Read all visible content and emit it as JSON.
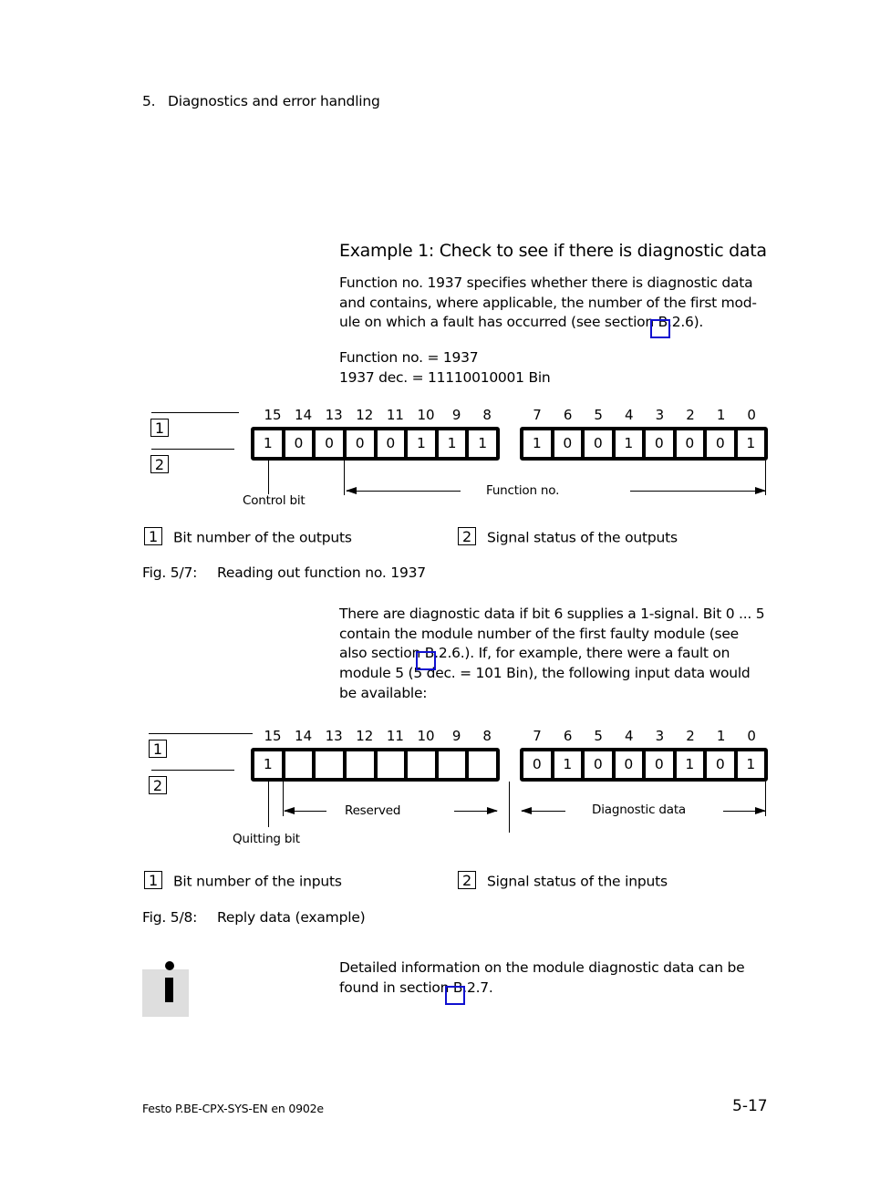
{
  "header": {
    "chapter_number": "5.",
    "chapter_title": "Diagnostics and error handling"
  },
  "example": {
    "heading": "Example 1: Check to see if there is diagnostic data",
    "paragraph1_lines": [
      "Function no. 1937 specifies whether there is diagnostic data",
      "and contains, where applicable, the number of the first mod-",
      "ule on which a fault has occurred (see section B.2.6)."
    ],
    "paragraph2_lines": [
      "Function no. = 1937",
      "1937 dec. = 11110010001 Bin"
    ]
  },
  "figure1": {
    "key1": "1",
    "key2": "2",
    "bit_numbers_high": [
      "15",
      "14",
      "13",
      "12",
      "11",
      "10",
      "9",
      "8"
    ],
    "bit_numbers_low": [
      "7",
      "6",
      "5",
      "4",
      "3",
      "2",
      "1",
      "0"
    ],
    "values_high": [
      "1",
      "0",
      "0",
      "0",
      "0",
      "1",
      "1",
      "1"
    ],
    "values_low": [
      "1",
      "0",
      "0",
      "1",
      "0",
      "0",
      "0",
      "1"
    ],
    "label_control_bit": "Control bit",
    "label_function_no": "Function no.",
    "legend1": "Bit number of the outputs",
    "legend2": "Signal status of the outputs",
    "caption_number": "Fig. 5/7:",
    "caption_text": "Reading out function no. 1937"
  },
  "paragraph3_lines": [
    "There are diagnostic data if bit 6 supplies a 1-signal. Bit 0 ... 5",
    "contain the module number of the first faulty module (see",
    "also section B.2.6.). If, for example, there were a fault on",
    "module 5 (5 dec. = 101 Bin), the following input data would",
    "be available:"
  ],
  "figure2": {
    "key1": "1",
    "key2": "2",
    "bit_numbers_high": [
      "15",
      "14",
      "13",
      "12",
      "11",
      "10",
      "9",
      "8"
    ],
    "bit_numbers_low": [
      "7",
      "6",
      "5",
      "4",
      "3",
      "2",
      "1",
      "0"
    ],
    "values_high": [
      "1",
      "",
      "",
      "",
      "",
      "",
      "",
      ""
    ],
    "values_low": [
      "0",
      "1",
      "0",
      "0",
      "0",
      "1",
      "0",
      "1"
    ],
    "label_quitting_bit": "Quitting bit",
    "label_reserved": "Reserved",
    "label_diagnostic_data": "Diagnostic data",
    "legend1": "Bit number of the inputs",
    "legend2": "Signal status of the inputs",
    "caption_number": "Fig. 5/8:",
    "caption_text": "Reply data (example)"
  },
  "note": {
    "icon": "info-icon",
    "lines": [
      "Detailed information on the module diagnostic data can be",
      "found in section B.2.7."
    ]
  },
  "footer": {
    "document_id": "Festo P.BE-CPX-SYS-EN  en 0902e",
    "page_number": "5-17"
  },
  "colors": {
    "xref_highlight": "#1010d0",
    "info_background": "#dedede"
  }
}
